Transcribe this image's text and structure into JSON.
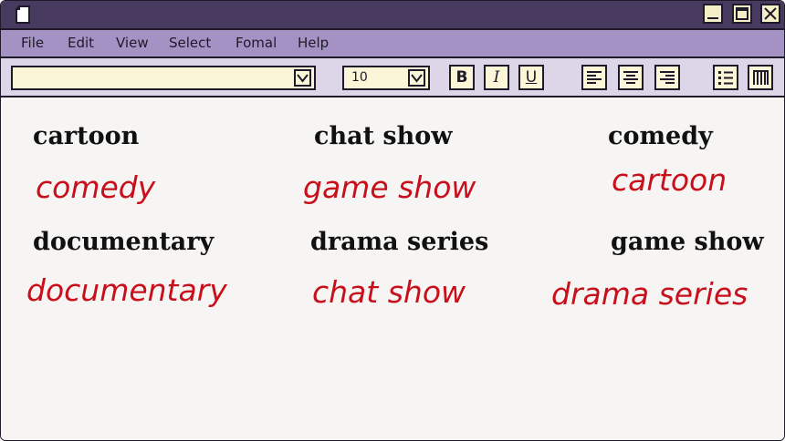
{
  "menu": [
    "File",
    "Edit",
    "View",
    "Select",
    "Fomal",
    "Help"
  ],
  "toolbar": {
    "font_value": "",
    "size_value": "10",
    "bold_label": "B",
    "italic_label": "I",
    "underline_label": "U"
  },
  "icons": {
    "document": "document-icon",
    "minimize": "minimize-icon",
    "maximize": "maximize-icon",
    "close": "close-icon",
    "dropdown": "chevron-down-icon",
    "align_left": "align-left-icon",
    "align_center": "align-center-icon",
    "align_right": "align-right-icon",
    "list": "bulleted-list-icon",
    "columns": "columns-icon"
  },
  "colors": {
    "titlebar": "#483a5e",
    "menubar": "#a592c4",
    "toolbar": "#ddd6e8",
    "field": "#fbf6d7",
    "answer_text": "#c8101c",
    "printed_text": "#111111"
  },
  "words": [
    "cartoon",
    "chat show",
    "comedy",
    "documentary",
    "drama series",
    "game show"
  ],
  "answers": [
    "comedy",
    "game show",
    "cartoon",
    "documentary",
    "chat show",
    "drama series"
  ]
}
